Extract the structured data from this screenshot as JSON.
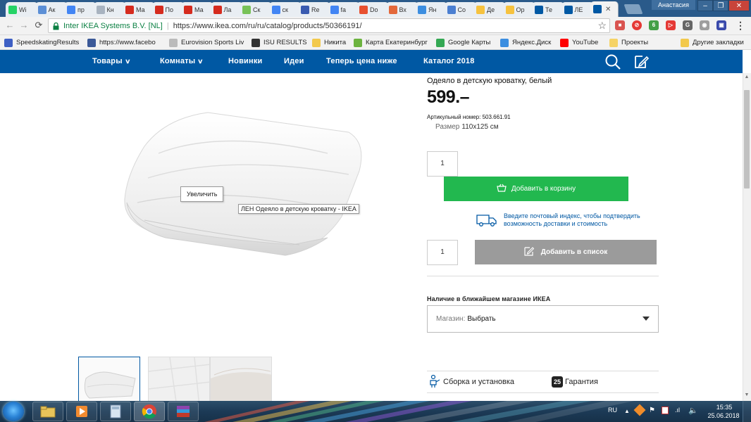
{
  "browser": {
    "tabs": [
      {
        "label": "Wі",
        "icon": "whatsapp-icon",
        "color": "#25d366"
      },
      {
        "label": "Ак",
        "icon": "upload-icon",
        "color": "#5b8fd6"
      },
      {
        "label": "пр",
        "icon": "google-icon",
        "color": "#4285f4"
      },
      {
        "label": "Кн",
        "icon": "ab-icon",
        "color": "#a8b3c0"
      },
      {
        "label": "Ма",
        "icon": "mcdonalds-icon",
        "color": "#d52b1e"
      },
      {
        "label": "По",
        "icon": "mcdonalds-icon",
        "color": "#d52b1e"
      },
      {
        "label": "Ма",
        "icon": "mcdonalds-icon",
        "color": "#d52b1e"
      },
      {
        "label": "Ла",
        "icon": "mcdonalds-icon",
        "color": "#d52b1e"
      },
      {
        "label": "Ск",
        "icon": "android-icon",
        "color": "#78c257"
      },
      {
        "label": "ск",
        "icon": "google-icon",
        "color": "#4285f4"
      },
      {
        "label": "Re",
        "icon": "v-icon",
        "color": "#3a5bb0"
      },
      {
        "label": "fa",
        "icon": "google-icon",
        "color": "#4285f4"
      },
      {
        "label": "Do",
        "icon": "chrome-icon",
        "color": "#e8502f"
      },
      {
        "label": "Вх",
        "icon": "mail-icon",
        "color": "#e3683a"
      },
      {
        "label": "Ян",
        "icon": "yandex-disk-icon",
        "color": "#3c8ee0"
      },
      {
        "label": "Со",
        "icon": "copyright-icon",
        "color": "#4b7fd1"
      },
      {
        "label": "Де",
        "icon": "circle-yellow-icon",
        "color": "#f6c23e"
      },
      {
        "label": "Ор",
        "icon": "circle-yellow-icon",
        "color": "#f6c23e"
      },
      {
        "label": "Те",
        "icon": "ikea-icon",
        "color": "#0058a3"
      },
      {
        "label": "ЛЕ",
        "icon": "ikea-icon",
        "color": "#0058a3"
      }
    ],
    "active_tab_icon": "ikea-icon",
    "user_name": "Анастасия",
    "secure_label": "Inter IKEA Systems B.V. [NL]",
    "url": "https://www.ikea.com/ru/ru/catalog/products/50366191/",
    "bookmarks": [
      {
        "label": "SpeedskatingResults",
        "icon": "speedskating-icon",
        "color": "#3d5fc4"
      },
      {
        "label": "https://www.facebo",
        "icon": "facebook-icon",
        "color": "#3b5998"
      },
      {
        "label": "Eurovision Sports Liv",
        "icon": "page-icon",
        "color": "#bbbbbb"
      },
      {
        "label": "ISU RESULTS",
        "icon": "sce-icon",
        "color": "#333333"
      },
      {
        "label": "Никита",
        "icon": "folder-icon",
        "color": "#f2c94c"
      },
      {
        "label": "Карта Екатеринбург",
        "icon": "map-icon",
        "color": "#6cb33f"
      },
      {
        "label": "Google Карты",
        "icon": "google-maps-icon",
        "color": "#34a853"
      },
      {
        "label": "Яндекс.Диск",
        "icon": "yandex-disk-icon",
        "color": "#3c8ee0"
      },
      {
        "label": "YouTube",
        "icon": "youtube-icon",
        "color": "#ff0000"
      },
      {
        "label": "Проекты",
        "icon": "sun-icon",
        "color": "#f6d365"
      }
    ],
    "other_bookmarks": "Другие закладки"
  },
  "ikea": {
    "nav": [
      {
        "label": "Товары",
        "has_chevron": true
      },
      {
        "label": "Комнаты",
        "has_chevron": true
      },
      {
        "label": "Новинки",
        "has_chevron": false
      },
      {
        "label": "Идеи",
        "has_chevron": false
      },
      {
        "label": "Теперь цена ниже",
        "has_chevron": false
      },
      {
        "label": "Каталог 2018",
        "has_chevron": false
      }
    ],
    "nav_icons": [
      "search-icon",
      "shopping-list-icon"
    ],
    "brand_color": "#0058a3"
  },
  "product": {
    "name": "Одеяло в детскую кроватку, белый",
    "price": "599.–",
    "article": "Артикульный номер: 503.661.91",
    "size_label": "Размер",
    "size_value": "110x125 см",
    "zoom_tooltip": "Увеличить",
    "image_alt_tooltip": "ЛЕН Одеяло в детскую кроватку  - IKEA",
    "cart_qty": "1",
    "add_to_cart": "Добавить в корзину",
    "delivery_text": "Введите почтовый индекс, чтобы подтвердить возможность доставки и стоимость",
    "list_qty": "1",
    "add_to_list": "Добавить в список",
    "stock_heading": "Наличие в ближайшем магазине ИКЕА",
    "store_label": "Магазин:",
    "store_value": "Выбрать",
    "assembly": "Сборка и установка",
    "warranty_years": "25",
    "warranty": "Гарантия",
    "cart_color": "#22b84f",
    "list_color": "#9b9b9b"
  },
  "taskbar": {
    "apps": [
      "explorer-icon",
      "media-player-icon",
      "calculator-icon",
      "chrome-icon",
      "winrar-icon"
    ],
    "language": "RU",
    "time": "15:35",
    "date": "25.06.2018"
  }
}
